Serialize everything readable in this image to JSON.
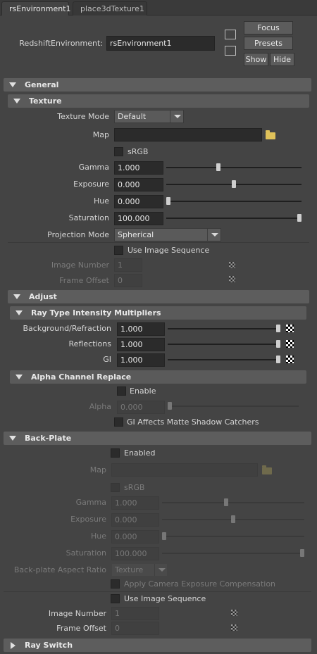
{
  "tabs": [
    "rsEnvironment1",
    "place3dTexture1"
  ],
  "node": {
    "type_label": "RedshiftEnvironment:",
    "name": "rsEnvironment1",
    "focus": "Focus",
    "presets": "Presets",
    "show": "Show",
    "hide": "Hide"
  },
  "general": {
    "title": "General",
    "texture": {
      "title": "Texture",
      "mode_label": "Texture Mode",
      "mode_value": "Default",
      "map_label": "Map",
      "map_value": "",
      "srgb_label": "sRGB",
      "gamma_label": "Gamma",
      "gamma": "1.000",
      "gamma_pos": 0.38,
      "exposure_label": "Exposure",
      "exposure": "0.000",
      "exposure_pos": 0.5,
      "hue_label": "Hue",
      "hue": "0.000",
      "hue_pos": 0.0,
      "saturation_label": "Saturation",
      "saturation": "100.000",
      "saturation_pos": 1.0,
      "projection_label": "Projection Mode",
      "projection_value": "Spherical",
      "use_seq_label": "Use Image Sequence",
      "image_number_label": "Image Number",
      "image_number": "1",
      "frame_offset_label": "Frame Offset",
      "frame_offset": "0"
    }
  },
  "adjust": {
    "title": "Adjust",
    "ray": {
      "title": "Ray Type Intensity Multipliers",
      "bg_label": "Background/Refraction",
      "bg": "1.000",
      "bg_pos": 1.0,
      "refl_label": "Reflections",
      "refl": "1.000",
      "refl_pos": 1.0,
      "gi_label": "GI",
      "gi": "1.000",
      "gi_pos": 1.0
    },
    "alpha": {
      "title": "Alpha Channel Replace",
      "enable_label": "Enable",
      "alpha_label": "Alpha",
      "alpha": "0.000",
      "alpha_pos": 0.0,
      "gi_matte_label": "GI Affects Matte Shadow Catchers"
    }
  },
  "backplate": {
    "title": "Back-Plate",
    "enabled_label": "Enabled",
    "map_label": "Map",
    "map_value": "",
    "srgb_label": "sRGB",
    "gamma_label": "Gamma",
    "gamma": "1.000",
    "gamma_pos": 0.45,
    "exposure_label": "Exposure",
    "exposure": "0.000",
    "exposure_pos": 0.5,
    "hue_label": "Hue",
    "hue": "0.000",
    "hue_pos": 0.0,
    "saturation_label": "Saturation",
    "saturation": "100.000",
    "saturation_pos": 1.0,
    "aspect_label": "Back-plate Aspect Ratio",
    "aspect_value": "Texture",
    "cam_exposure_label": "Apply Camera Exposure Compensation",
    "use_seq_label": "Use Image Sequence",
    "image_number_label": "Image Number",
    "image_number": "1",
    "frame_offset_label": "Frame Offset",
    "frame_offset": "0"
  },
  "ray_switch": {
    "title": "Ray Switch"
  },
  "colors": {
    "panel": "#444444",
    "section": "#5d5d5d",
    "field": "#2b2b2b",
    "folder": "#e0c25a"
  }
}
